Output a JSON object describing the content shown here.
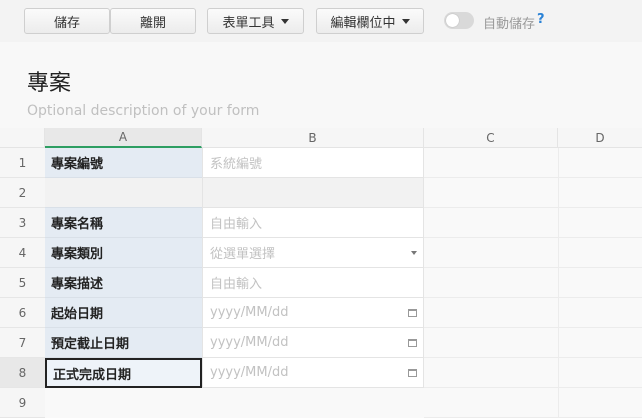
{
  "toolbar": {
    "save_label": "儲存",
    "leave_label": "離開",
    "form_tools_label": "表單工具",
    "edit_fields_label": "編輯欄位中",
    "autosave_label": "自動儲存",
    "help_label": "?",
    "autosave_on": false
  },
  "form": {
    "title": "專案",
    "description_placeholder": "Optional description of your form"
  },
  "columns": [
    "A",
    "B",
    "C",
    "D"
  ],
  "rows": [
    {
      "num": "1",
      "label": "專案編號",
      "hint": "系統編號",
      "icon": "none"
    },
    {
      "num": "2",
      "label": "",
      "hint": "",
      "icon": "none"
    },
    {
      "num": "3",
      "label": "專案名稱",
      "hint": "自由輸入",
      "icon": "none"
    },
    {
      "num": "4",
      "label": "專案類別",
      "hint": "從選單選擇",
      "icon": "dropdown-arrow-icon"
    },
    {
      "num": "5",
      "label": "專案描述",
      "hint": "自由輸入",
      "icon": "none"
    },
    {
      "num": "6",
      "label": "起始日期",
      "hint": "yyyy/MM/dd",
      "icon": "calendar-icon"
    },
    {
      "num": "7",
      "label": "預定截止日期",
      "hint": "yyyy/MM/dd",
      "icon": "calendar-icon"
    },
    {
      "num": "8",
      "label": "正式完成日期",
      "hint": "yyyy/MM/dd",
      "icon": "calendar-icon"
    },
    {
      "num": "9",
      "label": "",
      "hint": "",
      "icon": "none"
    }
  ],
  "colors": {
    "label_cell_bg": "#e4ebf3",
    "selected_column_underline": "#2e9e62",
    "help_color": "#2a82d6"
  }
}
